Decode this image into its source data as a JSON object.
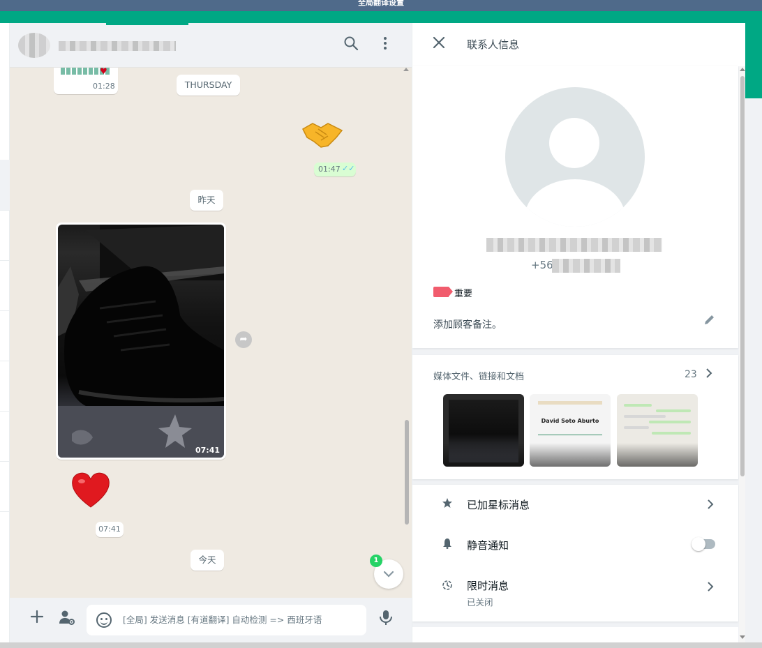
{
  "window": {
    "top_title": "全局翻译设置"
  },
  "chat": {
    "messages": {
      "first_bubble_time": "01:28",
      "date_thursday": "THURSDAY",
      "handshake_time": "01:47",
      "date_yesterday": "昨天",
      "photo_time": "07:41",
      "heart_time": "07:41",
      "date_today": "今天"
    },
    "unread_count": "1",
    "compose": {
      "placeholder": "[全局] 发送消息 [有道翻译] 自动检测 => 西班牙语"
    },
    "icons": {
      "search": "search-icon",
      "menu": "more-vertical-icon",
      "attach": "plus-icon",
      "contact": "person-gear-icon",
      "emoji": "sticker-icon",
      "mic": "microphone-icon",
      "forward": "forward-icon",
      "scroll_down": "chevron-down-icon"
    }
  },
  "contact_info": {
    "title": "联系人信息",
    "phone_prefix": "+56",
    "label": {
      "text": "重要",
      "color": "#f15c6d"
    },
    "note_prompt": "添加顾客备注。",
    "media": {
      "title": "媒体文件、链接和文档",
      "count": "23",
      "doc_thumbnail_text": "David Soto Aburto"
    },
    "rows": [
      {
        "label": "已加星标消息",
        "icon": "star-icon"
      },
      {
        "label": "静音通知",
        "icon": "bell-icon",
        "toggle_on": false
      },
      {
        "label": "限时消息",
        "sublabel": "已关闭",
        "icon": "timer-icon"
      }
    ]
  },
  "colors": {
    "accent": "#00a884",
    "outgoing_bubble": "#d9fdd3",
    "chat_background": "#efeae2",
    "read_ticks": "#53bdeb"
  }
}
